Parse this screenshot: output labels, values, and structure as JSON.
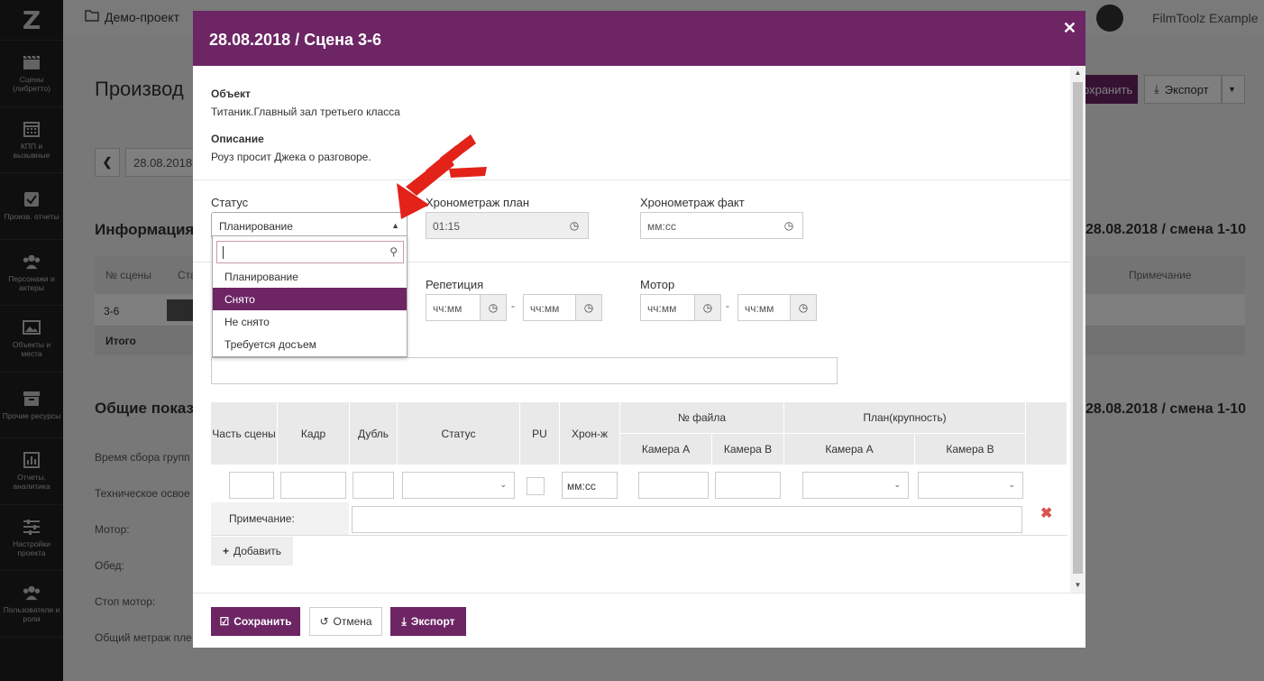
{
  "sidebar": {
    "logo": "Z",
    "items": [
      {
        "label": "Сцены (либретто)",
        "icon": "clapperboard-icon"
      },
      {
        "label": "КПП и вызывные",
        "icon": "calendar-icon"
      },
      {
        "label": "Произв. отчеты",
        "icon": "checkbox-icon"
      },
      {
        "label": "Персонажи и актеры",
        "icon": "people-icon"
      },
      {
        "label": "Объекты и места",
        "icon": "image-icon"
      },
      {
        "label": "Прочие ресурсы",
        "icon": "archive-icon"
      },
      {
        "label": "Отчеты, аналитика",
        "icon": "bar-chart-icon"
      },
      {
        "label": "Настройки проекта",
        "icon": "sliders-icon"
      },
      {
        "label": "Пользователи и роли",
        "icon": "users-icon"
      }
    ]
  },
  "topbar": {
    "breadcrumb": "Демо-проект",
    "user_name": "FilmToolz Example"
  },
  "background": {
    "title": "Производ",
    "save_label": "охранить",
    "export_label": "Экспорт",
    "date": "28.08.2018",
    "info_title": "Информация",
    "info_right": "28.08.2018 / смена 1-10",
    "col_scene": "№ сцены",
    "col_status": "Стат",
    "col_note": "Примечание",
    "row_scene": "3-6",
    "total_label": "Итого",
    "general_title": "Общие показ",
    "general_right": "28.08.2018 / смена 1-10",
    "rows": [
      "Время сбора групп",
      "Техническое освое",
      "Мотор:",
      "Обед:",
      "Стоп мотор:",
      "Общий метраж пле"
    ]
  },
  "modal": {
    "title": "28.08.2018 / Сцена 3-6",
    "object_label": "Объект",
    "object_value": "Титаник.Главный зал третьего класса",
    "description_label": "Описание",
    "description_value": "Роуз просит Джека о разговоре.",
    "status_label": "Статус",
    "status_value": "Планирование",
    "timing_plan_label": "Хронометраж план",
    "timing_plan_value": "01:15",
    "timing_fact_label": "Хронометраж факт",
    "timing_fact_placeholder": "мм:сс",
    "rehearsal_label": "Репетиция",
    "motor_label": "Мотор",
    "time_placeholder": "чч:мм",
    "dropdown": {
      "options": [
        "Планирование",
        "Снято",
        "Не снято",
        "Требуется досъем"
      ],
      "highlighted": "Снято"
    },
    "table": {
      "h_part": "Часть сцены",
      "h_frame": "Кадр",
      "h_take": "Дубль",
      "h_status": "Статус",
      "h_pu": "PU",
      "h_timing": "Хрон-ж",
      "h_file": "№ файла",
      "h_plan": "План(крупность)",
      "h_cam_a": "Камера A",
      "h_cam_b": "Камера B",
      "timing_placeholder": "мм:сс",
      "note_label": "Примечание:"
    },
    "add_label": "Добавить",
    "footer": {
      "save": "Сохранить",
      "cancel": "Отмена",
      "export": "Экспорт"
    }
  },
  "colors": {
    "accent": "#6d2564",
    "danger": "#d9534f",
    "arrow": "#e32219"
  }
}
